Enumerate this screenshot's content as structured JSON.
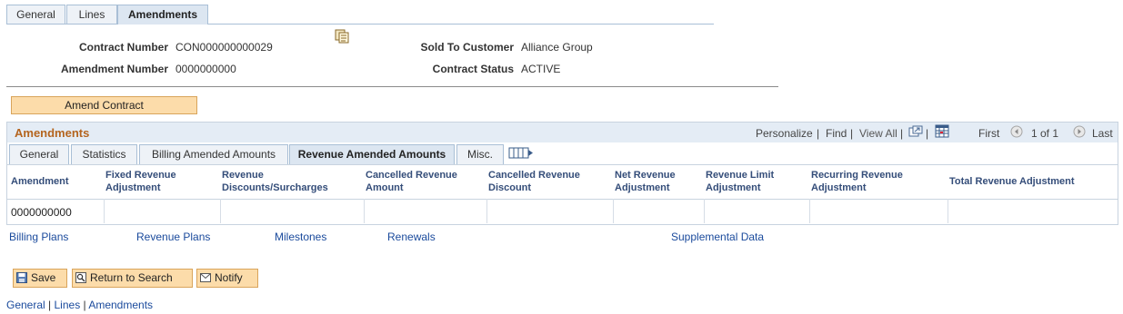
{
  "top_tabs": [
    {
      "label": "General",
      "active": false
    },
    {
      "label": "Lines",
      "active": false
    },
    {
      "label": "Amendments",
      "active": true
    }
  ],
  "header": {
    "contract_number_label": "Contract Number",
    "contract_number_value": "CON000000000029",
    "amendment_number_label": "Amendment Number",
    "amendment_number_value": "0000000000",
    "sold_to_label": "Sold To Customer",
    "sold_to_value": "Alliance Group",
    "status_label": "Contract Status",
    "status_value": "ACTIVE"
  },
  "amend_button": "Amend Contract",
  "grid": {
    "title": "Amendments",
    "personalize": "Personalize",
    "find": "Find",
    "view_all": "View All",
    "first": "First",
    "range": "1 of 1",
    "last": "Last",
    "tabs": [
      {
        "label": "General",
        "active": false
      },
      {
        "label": "Statistics",
        "active": false
      },
      {
        "label": "Billing Amended Amounts",
        "active": false
      },
      {
        "label": "Revenue Amended Amounts",
        "active": true
      },
      {
        "label": "Misc.",
        "active": false
      }
    ],
    "columns": [
      "Amendment",
      "Fixed Revenue Adjustment",
      "Revenue Discounts/Surcharges",
      "Cancelled Revenue Amount",
      "Cancelled Revenue Discount",
      "Net Revenue Adjustment",
      "Revenue Limit Adjustment",
      "Recurring Revenue Adjustment",
      "Total Revenue Adjustment"
    ],
    "rows": [
      [
        "0000000000",
        "",
        "",
        "",
        "",
        "",
        "",
        "",
        ""
      ]
    ]
  },
  "links": [
    "Billing Plans",
    "Revenue Plans",
    "Milestones",
    "Renewals",
    "Supplemental Data"
  ],
  "toolbar": {
    "save": "Save",
    "return": "Return to Search",
    "notify": "Notify"
  },
  "footer": [
    "General",
    "Lines",
    "Amendments"
  ],
  "colors": {
    "accent": "#b4641e",
    "link": "#1a4a9c",
    "button": "#fcdcaa"
  }
}
